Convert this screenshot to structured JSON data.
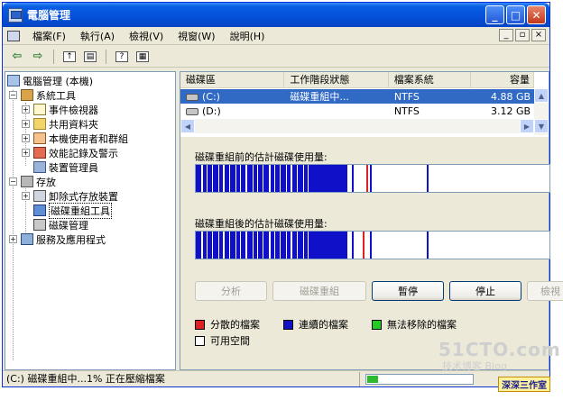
{
  "window": {
    "title": "電腦管理",
    "buttons": {
      "minimize": "_",
      "maximize": "□",
      "close": "✕"
    }
  },
  "menu": {
    "items": [
      "檔案(F)",
      "執行(A)",
      "檢視(V)",
      "視窗(W)",
      "說明(H)"
    ],
    "mdi": {
      "minimize": "_",
      "restore": "▫",
      "close": "×"
    }
  },
  "toolbar": {
    "icons": [
      "back-arrow-icon",
      "forward-arrow-icon",
      "up-folder-icon",
      "show-tree-icon",
      "help-icon",
      "properties-icon"
    ],
    "back": "⇦",
    "forward": "⇨"
  },
  "tree": {
    "root": "電腦管理 (本機)",
    "system_tools": "系統工具",
    "event_viewer": "事件檢視器",
    "shared_folders": "共用資料夾",
    "local_users": "本機使用者和群組",
    "perf_logs": "效能記錄及警示",
    "device_manager": "裝置管理員",
    "storage": "存放",
    "removable": "卸除式存放裝置",
    "defrag": "磁碟重組工具",
    "disk_mgmt": "磁碟管理",
    "services": "服務及應用程式"
  },
  "volumes": {
    "headers": [
      "磁碟區",
      "工作階段狀態",
      "檔案系統",
      "容量"
    ],
    "rows": [
      {
        "volume": "(C:)",
        "status": "磁碟重組中...",
        "fs": "NTFS",
        "capacity": "4.88 GB"
      },
      {
        "volume": "(D:)",
        "status": "",
        "fs": "NTFS",
        "capacity": "3.12 GB"
      }
    ]
  },
  "defrag": {
    "before_label": "磁碟重組前的估計磁碟使用量:",
    "after_label": "磁碟重組後的估計磁碟使用量:",
    "buttons": {
      "analyze": "分析",
      "defragment": "磁碟重組",
      "pause": "暫停",
      "stop": "停止",
      "view_report": "檢視"
    },
    "legend": {
      "fragmented": "分散的檔案",
      "contiguous": "連續的檔案",
      "unmovable": "無法移除的檔案",
      "free": "可用空間"
    },
    "colors": {
      "fragmented": "#e02020",
      "contiguous": "#1010c8",
      "unmovable": "#22cc22",
      "free": "#ffffff"
    }
  },
  "status": {
    "text": "(C:) 磁碟重組中...1% 正在壓縮檔案",
    "progress": 0.1
  },
  "overlay": {
    "watermark": "51CTO.com",
    "watermark_sub": "技术博客 Blog",
    "stamp": "深深三作室"
  }
}
